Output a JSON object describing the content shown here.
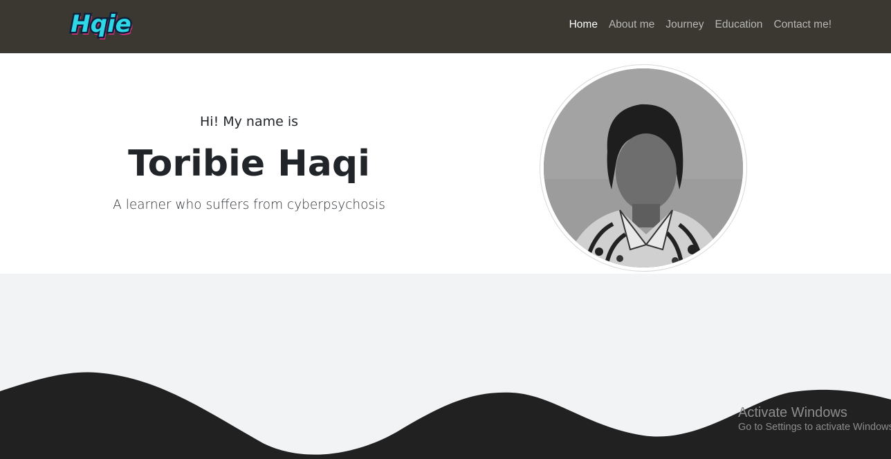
{
  "logo": {
    "text": "Hqie"
  },
  "nav": {
    "items": [
      {
        "label": "Home",
        "active": true
      },
      {
        "label": "About me",
        "active": false
      },
      {
        "label": "Journey",
        "active": false
      },
      {
        "label": "Education",
        "active": false
      },
      {
        "label": "Contact me!",
        "active": false
      }
    ]
  },
  "hero": {
    "greeting": "Hi! My name is",
    "name": "Toribie Haqi",
    "tagline": "A learner who suffers from cyberpsychosis",
    "photo_icon": "profile-photo"
  },
  "os_watermark": {
    "title": "Activate Windows",
    "subtitle": "Go to Settings to activate Windows."
  },
  "colors": {
    "navbar": "#3a3831",
    "hero_bg": "#ffffff",
    "section_bg": "#f2f3f5",
    "wave": "#212121",
    "logo_cyan": "#2fd6e6",
    "logo_magenta": "#e0337e"
  }
}
